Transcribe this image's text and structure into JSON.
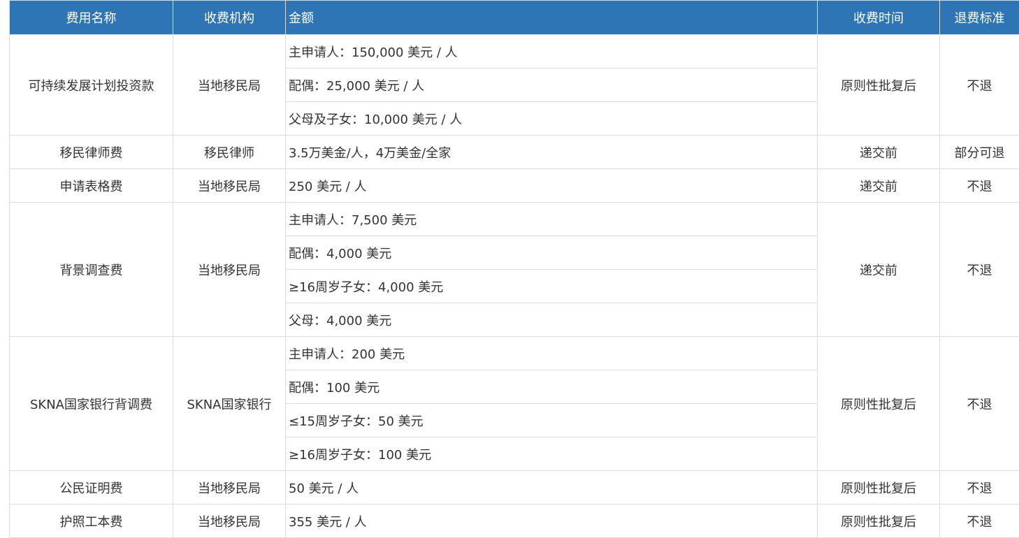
{
  "headers": [
    "费用名称",
    "收费机构",
    "金额",
    "收费时间",
    "退费标准"
  ],
  "rows": [
    {
      "name": "可持续发展计划投资款",
      "org": "当地移民局",
      "amounts": [
        "主申请人：150,000 美元 / 人",
        "配偶：25,000 美元 / 人",
        "父母及子女：10,000 美元 / 人"
      ],
      "time": "原则性批复后",
      "refund": "不退"
    },
    {
      "name": "移民律师费",
      "org": "移民律师",
      "amounts": [
        "3.5万美金/人，4万美金/全家"
      ],
      "time": "递交前",
      "refund": "部分可退"
    },
    {
      "name": "申请表格费",
      "org": "当地移民局",
      "amounts": [
        "250 美元 / 人"
      ],
      "time": "递交前",
      "refund": "不退"
    },
    {
      "name": "背景调查费",
      "org": "当地移民局",
      "amounts": [
        "主申请人：7,500 美元",
        "配偶：4,000 美元",
        "≥16周岁子女：4,000 美元",
        "父母：4,000 美元"
      ],
      "time": "递交前",
      "refund": "不退"
    },
    {
      "name": "SKNA国家银行背调费",
      "org": "SKNA国家银行",
      "amounts": [
        "主申请人：200 美元",
        "配偶：100 美元",
        "≤15周岁子女：50 美元",
        "≥16周岁子女：100 美元"
      ],
      "time": "原则性批复后",
      "refund": "不退"
    },
    {
      "name": "公民证明费",
      "org": "当地移民局",
      "amounts": [
        "50 美元 / 人"
      ],
      "time": "原则性批复后",
      "refund": "不退"
    },
    {
      "name": "护照工本费",
      "org": "当地移民局",
      "amounts": [
        "355 美元 / 人"
      ],
      "time": "原则性批复后",
      "refund": "不退"
    }
  ]
}
